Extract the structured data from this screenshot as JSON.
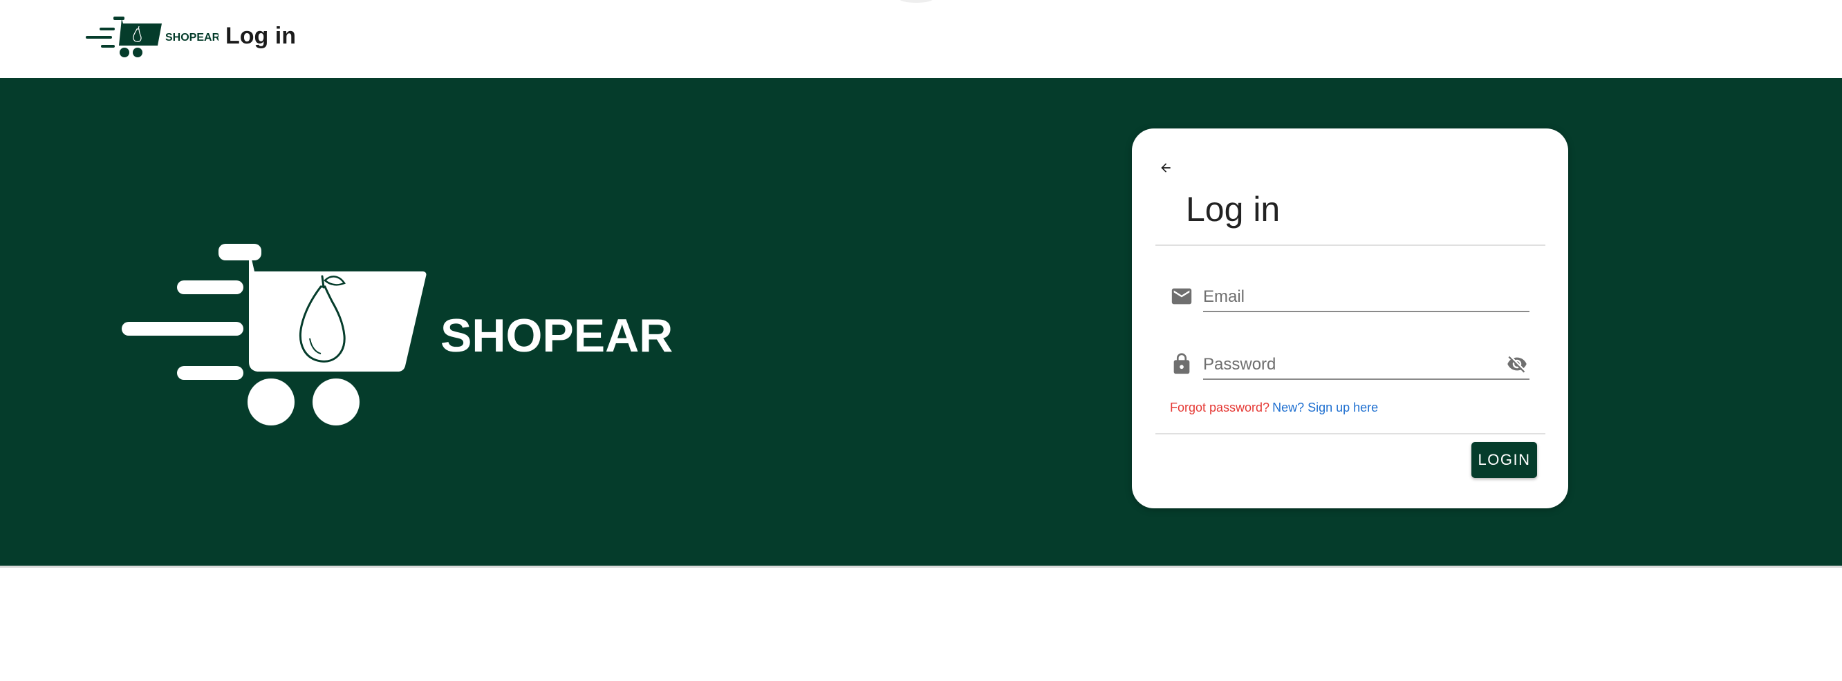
{
  "header": {
    "brand": "SHOPEAR",
    "title": "Log in"
  },
  "hero": {
    "brand": "SHOPEAR"
  },
  "login_card": {
    "title": "Log in",
    "email_placeholder": "Email",
    "password_placeholder": "Password",
    "forgot_label": "Forgot password?",
    "signup_label": "New? Sign up here",
    "login_label": "LOGIN"
  },
  "icons": {
    "back": "arrow-left-icon",
    "email": "mail-icon",
    "password": "lock-icon",
    "visibility": "eye-off-icon",
    "logo": "shopping-cart-pear-logo"
  },
  "colors": {
    "brand_green": "#053c2b",
    "forgot_red": "#e53935",
    "signup_blue": "#1e6fd0"
  }
}
